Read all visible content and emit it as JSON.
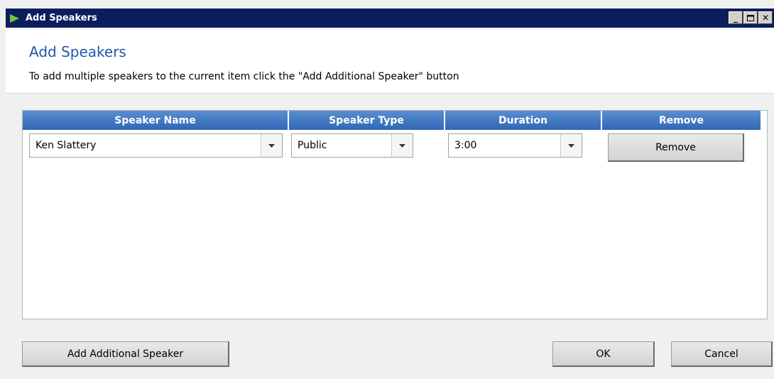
{
  "window": {
    "title": "Add Speakers"
  },
  "header": {
    "title": "Add Speakers",
    "subtitle": "To add multiple speakers to the current item click the \"Add Additional Speaker\" button"
  },
  "grid": {
    "columns": [
      "Speaker Name",
      "Speaker Type",
      "Duration",
      "Remove"
    ],
    "rows": [
      {
        "speaker_name": "Ken Slattery",
        "speaker_type": "Public",
        "duration": "3:00",
        "remove_label": "Remove"
      }
    ]
  },
  "footer": {
    "add_label": "Add Additional Speaker",
    "ok_label": "OK",
    "cancel_label": "Cancel"
  },
  "colors": {
    "titlebar": "#0a1e5e",
    "header_title": "#1e5aa8",
    "grid_header": "#2f67b4"
  }
}
